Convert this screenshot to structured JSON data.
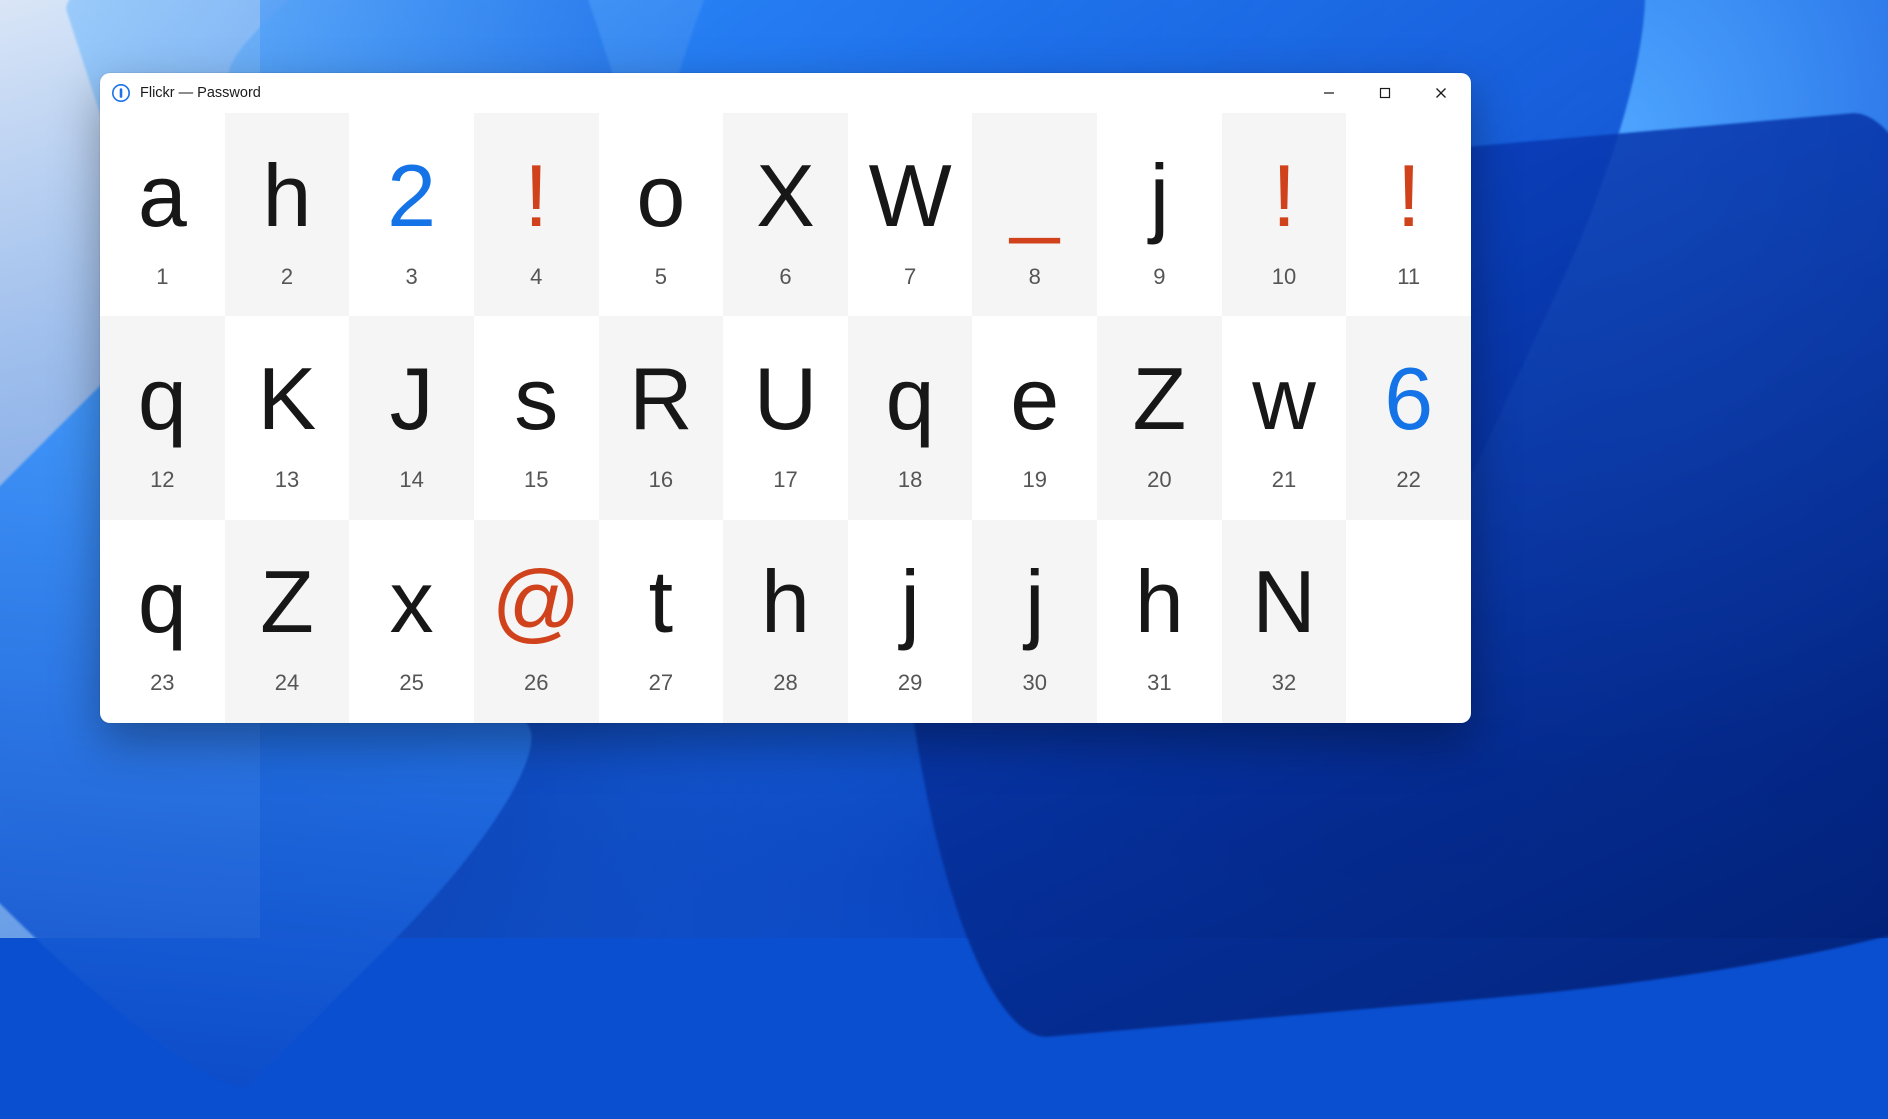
{
  "window": {
    "title": "Flickr — Password",
    "app_icon_name": "onepassword-icon"
  },
  "colors": {
    "letter": "#171717",
    "digit": "#1473e6",
    "symbol": "#d0421b",
    "cell_shade": "#f5f5f5",
    "index_text": "#555555"
  },
  "password_chars": [
    {
      "index": 1,
      "char": "a",
      "kind": "letter"
    },
    {
      "index": 2,
      "char": "h",
      "kind": "letter"
    },
    {
      "index": 3,
      "char": "2",
      "kind": "digit"
    },
    {
      "index": 4,
      "char": "!",
      "kind": "symbol"
    },
    {
      "index": 5,
      "char": "o",
      "kind": "letter"
    },
    {
      "index": 6,
      "char": "X",
      "kind": "letter"
    },
    {
      "index": 7,
      "char": "W",
      "kind": "letter"
    },
    {
      "index": 8,
      "char": "_",
      "kind": "symbol"
    },
    {
      "index": 9,
      "char": "j",
      "kind": "letter"
    },
    {
      "index": 10,
      "char": "!",
      "kind": "symbol"
    },
    {
      "index": 11,
      "char": "!",
      "kind": "symbol"
    },
    {
      "index": 12,
      "char": "q",
      "kind": "letter"
    },
    {
      "index": 13,
      "char": "K",
      "kind": "letter"
    },
    {
      "index": 14,
      "char": "J",
      "kind": "letter"
    },
    {
      "index": 15,
      "char": "s",
      "kind": "letter"
    },
    {
      "index": 16,
      "char": "R",
      "kind": "letter"
    },
    {
      "index": 17,
      "char": "U",
      "kind": "letter"
    },
    {
      "index": 18,
      "char": "q",
      "kind": "letter"
    },
    {
      "index": 19,
      "char": "e",
      "kind": "letter"
    },
    {
      "index": 20,
      "char": "Z",
      "kind": "letter"
    },
    {
      "index": 21,
      "char": "w",
      "kind": "letter"
    },
    {
      "index": 22,
      "char": "6",
      "kind": "digit"
    },
    {
      "index": 23,
      "char": "q",
      "kind": "letter"
    },
    {
      "index": 24,
      "char": "Z",
      "kind": "letter"
    },
    {
      "index": 25,
      "char": "x",
      "kind": "letter"
    },
    {
      "index": 26,
      "char": "@",
      "kind": "symbol"
    },
    {
      "index": 27,
      "char": "t",
      "kind": "letter"
    },
    {
      "index": 28,
      "char": "h",
      "kind": "letter"
    },
    {
      "index": 29,
      "char": "j",
      "kind": "letter"
    },
    {
      "index": 30,
      "char": "j",
      "kind": "letter"
    },
    {
      "index": 31,
      "char": "h",
      "kind": "letter"
    },
    {
      "index": 32,
      "char": "N",
      "kind": "letter"
    }
  ]
}
